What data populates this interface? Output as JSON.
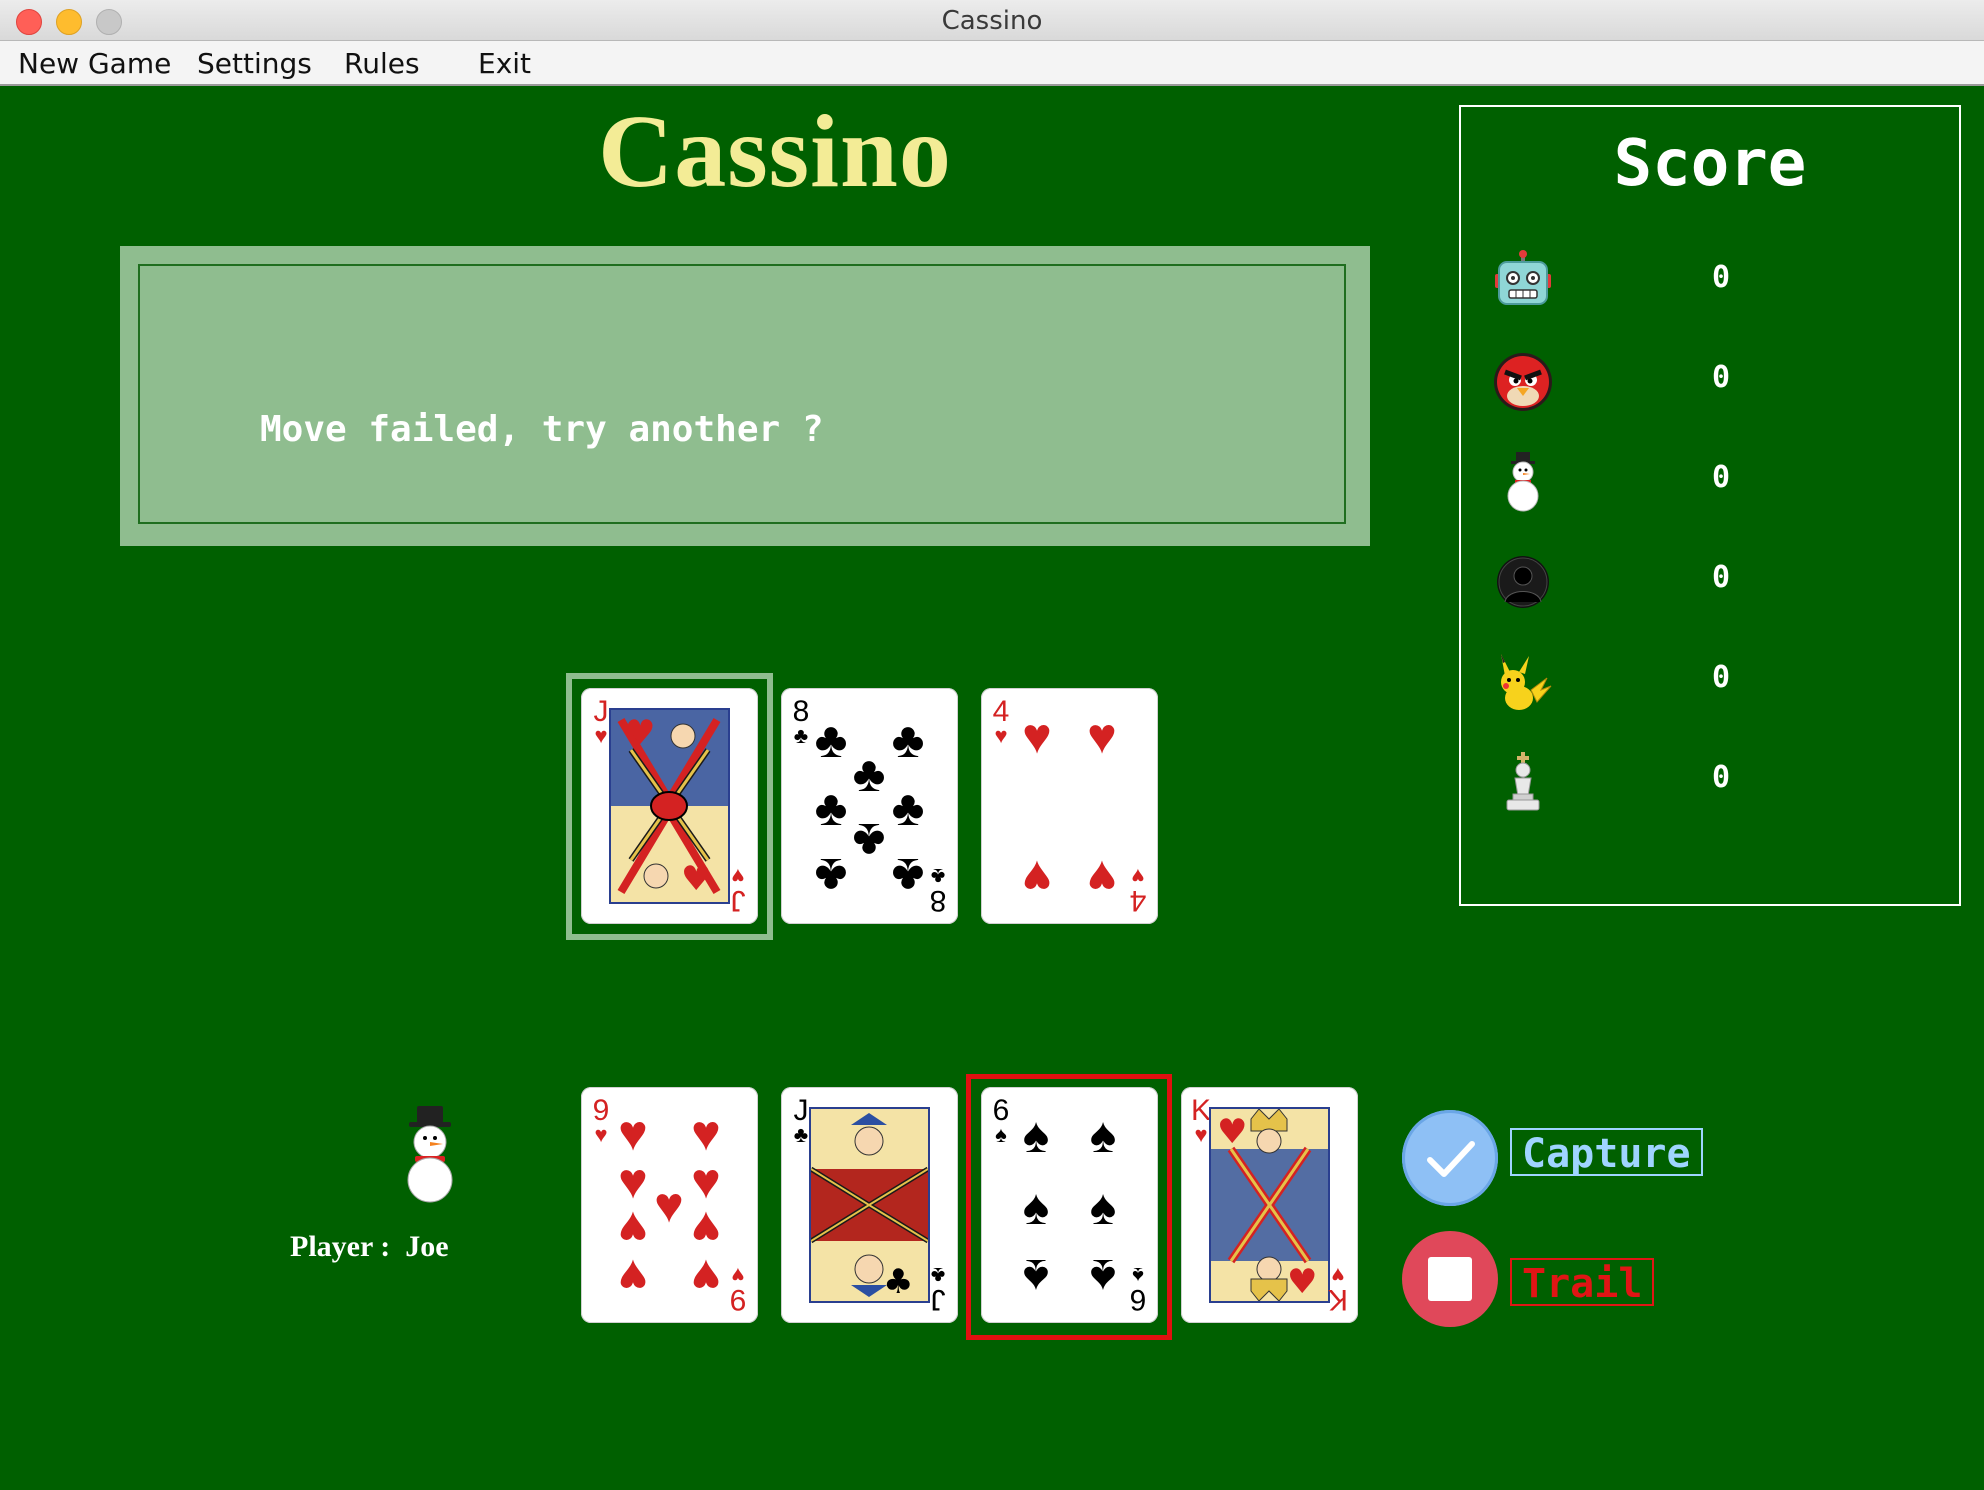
{
  "window": {
    "title": "Cassino",
    "traffic_colors": [
      "#ff5f57",
      "#febc2e",
      "#c8c8c8"
    ]
  },
  "menu": [
    {
      "label": "New Game"
    },
    {
      "label": "Settings"
    },
    {
      "label": "Rules"
    },
    {
      "label": "Exit"
    }
  ],
  "game": {
    "title": "Cassino",
    "title_color": "#f3ec96",
    "table_color": "#006000"
  },
  "message": {
    "text": "Move failed, try another ?"
  },
  "score": {
    "title": "Score",
    "rows": [
      {
        "avatar": "robot-icon",
        "value": "0"
      },
      {
        "avatar": "angry-bird-icon",
        "value": "0"
      },
      {
        "avatar": "snowman-icon",
        "value": "0"
      },
      {
        "avatar": "person-silhouette-icon",
        "value": "0"
      },
      {
        "avatar": "pikachu-icon",
        "value": "0"
      },
      {
        "avatar": "chess-king-icon",
        "value": "0"
      }
    ]
  },
  "table_cards": [
    {
      "rank": "J",
      "suit": "♥",
      "color": "red",
      "highlighted": true
    },
    {
      "rank": "8",
      "suit": "♣",
      "color": "black",
      "highlighted": false
    },
    {
      "rank": "4",
      "suit": "♥",
      "color": "red",
      "highlighted": false
    }
  ],
  "hand_cards": [
    {
      "rank": "9",
      "suit": "♥",
      "color": "red",
      "selected": false
    },
    {
      "rank": "J",
      "suit": "♣",
      "color": "black",
      "selected": false
    },
    {
      "rank": "6",
      "suit": "♠",
      "color": "black",
      "selected": true
    },
    {
      "rank": "K",
      "suit": "♥",
      "color": "red",
      "selected": false
    }
  ],
  "player": {
    "label": "Player :  Joe",
    "avatar": "snowman-icon"
  },
  "actions": {
    "capture": {
      "label": "Capture",
      "icon": "checkmark-icon",
      "color": "#8ec0f5",
      "text_color": "#9fd4ff"
    },
    "trail": {
      "label": "Trail",
      "icon": "stop-icon",
      "color": "#e0485a",
      "text_color": "#e01515"
    }
  }
}
